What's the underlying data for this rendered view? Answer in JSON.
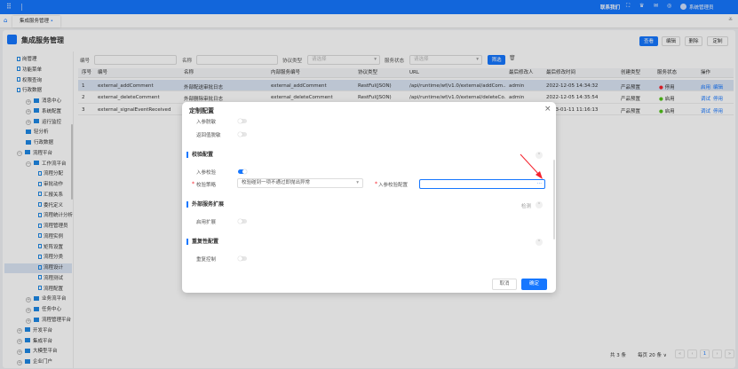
{
  "topbar": {
    "contact": "联系我们",
    "user": "系统管理员"
  },
  "tabs": [
    {
      "label": "集成服务管理"
    }
  ],
  "page": {
    "title": "集成服务管理",
    "buttons": [
      "查看",
      "编辑",
      "删除",
      "定制"
    ]
  },
  "sidebar": {
    "items": [
      {
        "label": "岗管理",
        "type": "doc",
        "lvl": 2
      },
      {
        "label": "功能菜单",
        "type": "doc",
        "lvl": 2
      },
      {
        "label": "权限查询",
        "type": "doc",
        "lvl": 2
      },
      {
        "label": "行政数据",
        "type": "doc",
        "lvl": 2
      },
      {
        "label": "消息中心",
        "type": "plus",
        "lvl": 1
      },
      {
        "label": "系统配置",
        "type": "plus",
        "lvl": 1
      },
      {
        "label": "运行监控",
        "type": "plus",
        "lvl": 1
      },
      {
        "label": "轻分析",
        "type": "fold",
        "lvl": 1
      },
      {
        "label": "行政数据",
        "type": "fold",
        "lvl": 1
      },
      {
        "label": "流程平台",
        "type": "minus",
        "lvl": 0
      },
      {
        "label": "工作流平台",
        "type": "minus",
        "lvl": 1
      },
      {
        "label": "流程分配",
        "type": "doc",
        "lvl": 3
      },
      {
        "label": "审批动作",
        "type": "doc",
        "lvl": 3
      },
      {
        "label": "汇报关系",
        "type": "doc",
        "lvl": 3
      },
      {
        "label": "委托定义",
        "type": "doc",
        "lvl": 3
      },
      {
        "label": "流程统计分析",
        "type": "doc",
        "lvl": 3
      },
      {
        "label": "流程管理员",
        "type": "doc",
        "lvl": 3
      },
      {
        "label": "流程实例",
        "type": "doc",
        "lvl": 3
      },
      {
        "label": "矩阵设置",
        "type": "doc",
        "lvl": 3
      },
      {
        "label": "流程分类",
        "type": "doc",
        "lvl": 3
      },
      {
        "label": "流程设计",
        "type": "doc",
        "lvl": 3,
        "selected": true
      },
      {
        "label": "流程测试",
        "type": "doc",
        "lvl": 3
      },
      {
        "label": "流程配置",
        "type": "doc",
        "lvl": 3
      },
      {
        "label": "业务流平台",
        "type": "plus",
        "lvl": 1
      },
      {
        "label": "任务中心",
        "type": "plus",
        "lvl": 1
      },
      {
        "label": "流程管理平台",
        "type": "plus",
        "lvl": 1
      },
      {
        "label": "开发平台",
        "type": "plus",
        "lvl": 0
      },
      {
        "label": "集成平台",
        "type": "plus",
        "lvl": 0
      },
      {
        "label": "大模型平台",
        "type": "plus",
        "lvl": 0
      },
      {
        "label": "企业门户",
        "type": "plus",
        "lvl": 0
      }
    ]
  },
  "filters": {
    "code_label": "编号",
    "name_label": "名称",
    "protocol_label": "协议类型",
    "protocol_placeholder": "请选择",
    "status_label": "服务状态",
    "status_placeholder": "请选择",
    "filter_button": "筛选"
  },
  "table": {
    "headers": [
      "序号",
      "编号",
      "名称",
      "内部服务编号",
      "协议类型",
      "URL",
      "最后修改人",
      "最后修改时间",
      "创建类型",
      "服务状态",
      "操作"
    ],
    "rows": [
      {
        "cells": [
          "1",
          "external_addComment",
          "外部配送审批日志",
          "external_addComment",
          "RestFul(JSON)",
          "/api/runtime/wf/v1.0/external/addCom...",
          "admin",
          "2022-12-05 14:34:32",
          "产品预置"
        ],
        "status": "停用",
        "status_color": "#f5222d",
        "actions": [
          "启用",
          "编辑"
        ],
        "selected": true
      },
      {
        "cells": [
          "2",
          "external_deleteComment",
          "外部删除审批日志",
          "external_deleteComment",
          "RestFul(JSON)",
          "/api/runtime/wf/v1.0/external/deleteCo...",
          "admin",
          "2022-12-05 14:35:54",
          "产品预置"
        ],
        "status": "启用",
        "status_color": "#52c41a",
        "actions": [
          "调试",
          "停用"
        ]
      },
      {
        "cells": [
          "3",
          "external_signalEventReceived",
          "",
          "",
          "",
          "",
          "",
          "2023-01-11 11:16:13",
          "产品预置"
        ],
        "status": "启用",
        "status_color": "#52c41a",
        "actions": [
          "调试",
          "停用"
        ]
      }
    ]
  },
  "pagination": {
    "total": "共 3 条",
    "page_size": "每页 20 条",
    "current": "1"
  },
  "modal": {
    "title": "定制配置",
    "mask_in": "入参脱敏",
    "mask_out": "返回值脱敏",
    "validate_section": "校验配置",
    "validate_in": "入参校验",
    "strategy_label": "校验策略",
    "strategy_value": "校验碰到一项不通过即抛出异常",
    "config_label": "入参校验配置",
    "config_button": "···",
    "ext_section": "外部服务扩展",
    "ext_check": "检测",
    "ext_enable": "启用扩展",
    "repeat_section": "重复性配置",
    "repeat_ctrl": "重复控制",
    "cancel": "取消",
    "ok": "确定"
  },
  "colors": {
    "primary": "#1677ff",
    "arrow": "#f5222d"
  }
}
